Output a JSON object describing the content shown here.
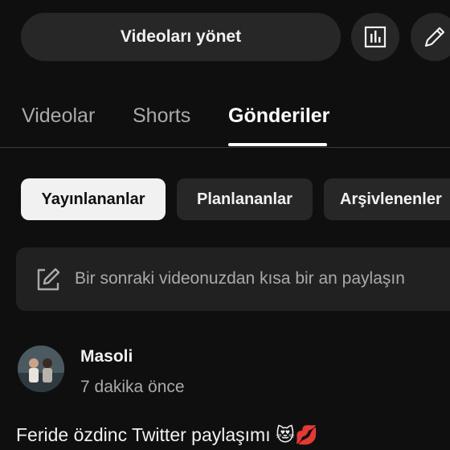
{
  "header": {
    "manage_videos_label": "Videoları yönet",
    "analytics_icon": "bar-chart-icon",
    "edit_icon": "pencil-icon"
  },
  "tabs": [
    {
      "label": "Videolar",
      "selected": false
    },
    {
      "label": "Shorts",
      "selected": false
    },
    {
      "label": "Gönderiler",
      "selected": true
    }
  ],
  "filters": [
    {
      "label": "Yayınlananlar",
      "selected": true
    },
    {
      "label": "Planlananlar",
      "selected": false
    },
    {
      "label": "Arşivlenenler",
      "selected": false
    }
  ],
  "composer": {
    "placeholder": "Bir sonraki videonuzdan kısa bir an paylaşın",
    "icon": "compose-icon"
  },
  "post": {
    "author": "Masoli",
    "time": "7 dakika önce",
    "text": "Feride özdinc Twitter paylaşımı 😻💋"
  },
  "colors": {
    "background": "#0f0f0f",
    "surface": "#272727",
    "selected_chip": "#f1f1f1",
    "secondary_text": "#aaaaaa"
  }
}
